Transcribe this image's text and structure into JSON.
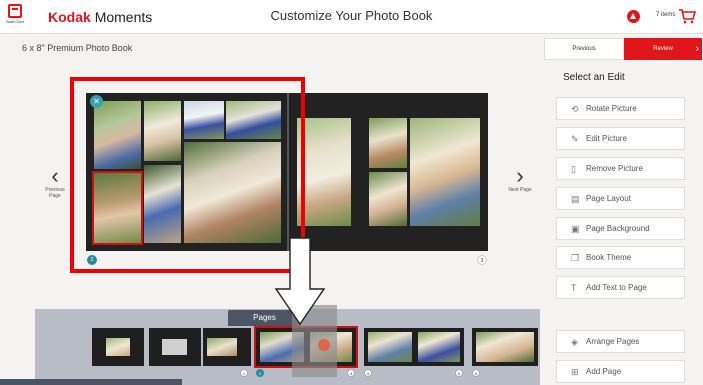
{
  "header": {
    "start_over_label": "Start Over",
    "brand_kodak": "Kodak",
    "brand_moments": "Moments",
    "title": "Customize Your Photo Book",
    "cart_count": "7 items",
    "accent": "#e0161b"
  },
  "book_title": "6 x 8\" Premium Photo Book",
  "nav": {
    "previous_label": "Previous",
    "review_label": "Review"
  },
  "spread": {
    "left_page_number": "2",
    "right_page_number": "3",
    "previous_page_label": "Previous Page",
    "next_page_label": "Next Page"
  },
  "edit_panel": {
    "title": "Select an Edit",
    "actions": [
      {
        "label": "Rotate Picture",
        "icon": "rotate-icon"
      },
      {
        "label": "Edit Picture",
        "icon": "pencil-icon"
      },
      {
        "label": "Remove Picture",
        "icon": "trash-icon"
      },
      {
        "label": "Page Layout",
        "icon": "layout-icon"
      },
      {
        "label": "Page Background",
        "icon": "background-icon"
      },
      {
        "label": "Book Theme",
        "icon": "theme-icon"
      },
      {
        "label": "Add Text to Page",
        "icon": "text-icon"
      },
      {
        "label": "Arrange Pages",
        "icon": "arrange-icon"
      },
      {
        "label": "Add Page",
        "icon": "add-page-icon"
      }
    ]
  },
  "pages_tray": {
    "tab_label": "Pages",
    "page_numbers": [
      "1",
      "2",
      "3",
      "4",
      "5",
      "6"
    ]
  }
}
